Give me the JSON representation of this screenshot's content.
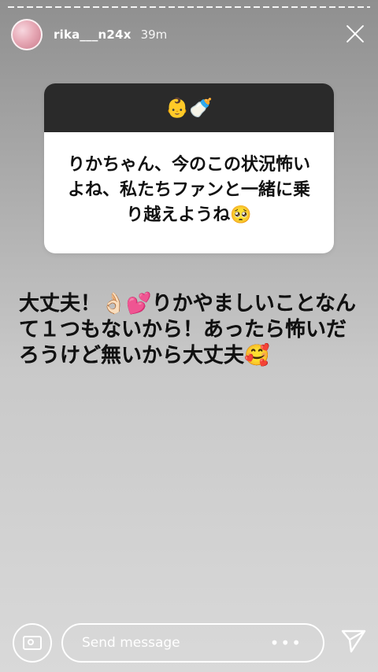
{
  "story": {
    "username": "rika___n24x",
    "time": "39m"
  },
  "question": {
    "emoji": "👶🍼",
    "text": "りかちゃん、今のこの状況怖いよね、私たちファンと一緒に乗り越えようね🥺"
  },
  "answer": {
    "text": "大丈夫！👌🏻💕りかやましいことなんて１つもないから！あったら怖いだろうけど無いから大丈夫🥰"
  },
  "composer": {
    "placeholder": "Send message",
    "more_label": "•••"
  }
}
